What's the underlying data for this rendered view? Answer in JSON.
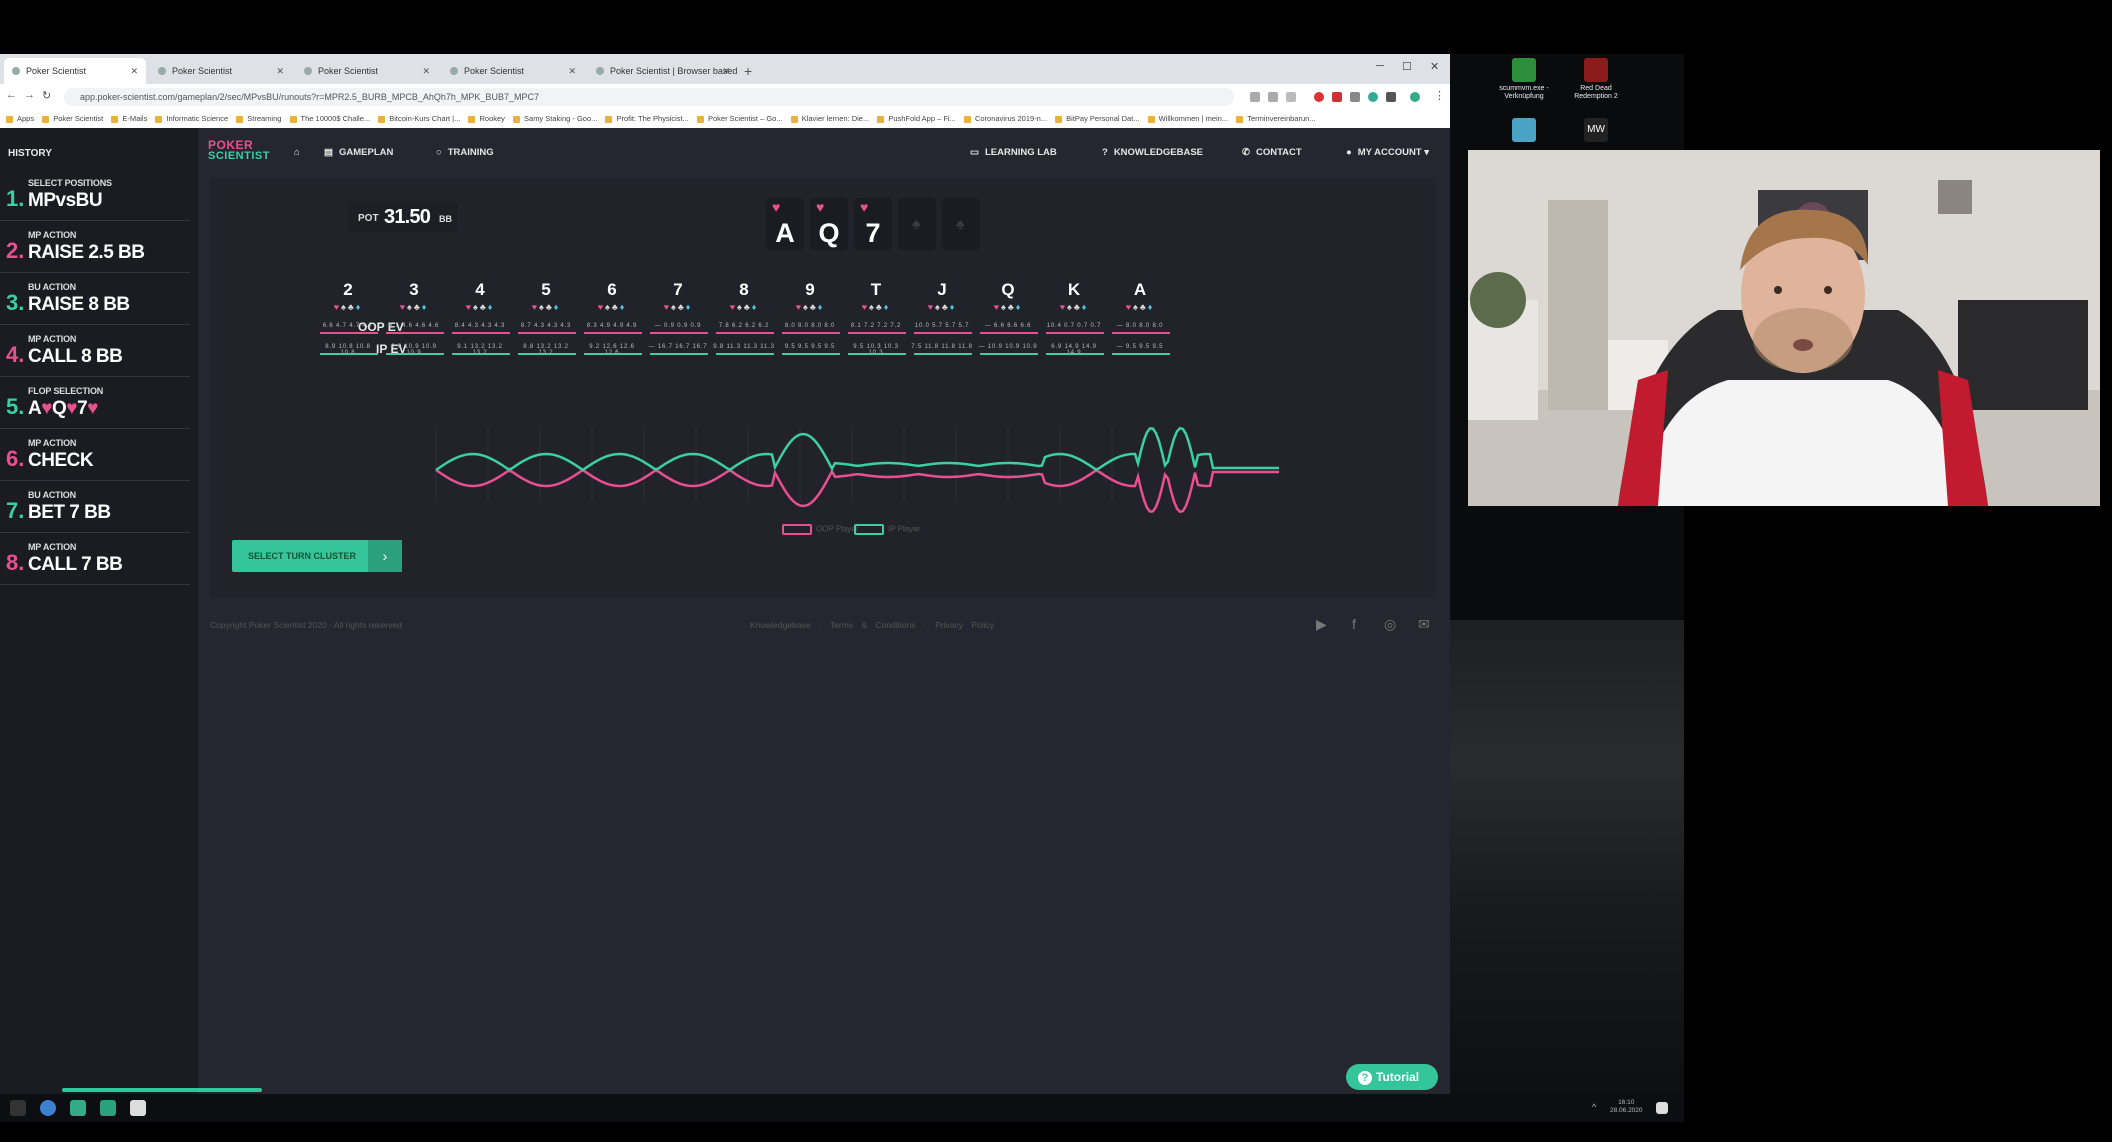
{
  "browser": {
    "tabs": [
      {
        "title": "Poker Scientist",
        "active": true
      },
      {
        "title": "Poker Scientist",
        "active": false
      },
      {
        "title": "Poker Scientist",
        "active": false
      },
      {
        "title": "Poker Scientist",
        "active": false
      },
      {
        "title": "Poker Scientist | Browser based",
        "active": false
      }
    ],
    "new_tab": "+",
    "url": "app.poker-scientist.com/gameplan/2/sec/MPvsBU/runouts?r=MPR2.5_BURB_MPCB_AhQh7h_MPK_BUB7_MPC7",
    "bookmarks": [
      "Apps",
      "Poker Scientist",
      "E-Mails",
      "Informatic Science",
      "Streaming",
      "The 10000$ Challe...",
      "Bitcoin-Kurs Chart |...",
      "Rookey",
      "Samy Staking - Goo...",
      "Profit: The Physicist...",
      "Poker Scientist – Go...",
      "Klavier lernen: Die...",
      "PushFold App – Fi...",
      "Coronavirus 2019-n...",
      "BitPay Personal Dat...",
      "Willkommen | mein...",
      "Terminvereinbarun..."
    ]
  },
  "sidebar": {
    "title": "HISTORY",
    "steps": [
      {
        "num": "1.",
        "label": "SELECT POSITIONS",
        "value": "MPvsBU",
        "color": "green"
      },
      {
        "num": "2.",
        "label": "MP ACTION",
        "value": "RAISE 2.5 BB",
        "color": "pink"
      },
      {
        "num": "3.",
        "label": "BU ACTION",
        "value": "RAISE 8 BB",
        "color": "green"
      },
      {
        "num": "4.",
        "label": "MP ACTION",
        "value": "CALL 8 BB",
        "color": "pink"
      },
      {
        "num": "5.",
        "label": "FLOP SELECTION",
        "value": "A♥Q♥7♥",
        "color": "green"
      },
      {
        "num": "6.",
        "label": "MP ACTION",
        "value": "CHECK",
        "color": "pink"
      },
      {
        "num": "7.",
        "label": "BU ACTION",
        "value": "BET 7 BB",
        "color": "green"
      },
      {
        "num": "8.",
        "label": "MP ACTION",
        "value": "CALL 7 BB",
        "color": "pink"
      }
    ]
  },
  "nav": {
    "gameplan": "GAMEPLAN",
    "training": "TRAINING",
    "learning_lab": "LEARNING LAB",
    "knowledgebase": "KNOWLEDGEBASE",
    "contact": "CONTACT",
    "account": "MY ACCOUNT"
  },
  "logo": {
    "line1": "POKER",
    "line2": "SCIENTIST"
  },
  "pot": {
    "label": "POT",
    "value": "31.50",
    "unit": "BB"
  },
  "board": {
    "cards": [
      {
        "rank": "A",
        "suit": "♥"
      },
      {
        "rank": "Q",
        "suit": "♥"
      },
      {
        "rank": "7",
        "suit": "♥"
      }
    ],
    "empty_slots": [
      "♠",
      "♠"
    ]
  },
  "runouts": {
    "ranks": [
      "2",
      "3",
      "4",
      "5",
      "6",
      "7",
      "8",
      "9",
      "T",
      "J",
      "Q",
      "K",
      "A"
    ],
    "suits": [
      "♥",
      "♠",
      "♣",
      "♦"
    ],
    "oop_label": "OOP EV",
    "ip_label": "IP EV",
    "oop_ev": [
      "6.6 4.7 4.7 4.7",
      "8.1 4.6 4.6 4.6",
      "8.4 4.3 4.3 4.3",
      "8.7 4.3 4.3 4.3",
      "8.3 4.9 4.9 4.9",
      "— 0.9 0.9 0.9",
      "7.8 6.2 6.2 6.2",
      "8.0 8.0 8.0 8.0",
      "8.1 7.2 7.2 7.2",
      "10.0 5.7 5.7 5.7",
      "— 6.6 6.6 6.6",
      "10.4 0.7 0.7 0.7",
      "— 8.0 8.0 8.0"
    ],
    "ip_ev": [
      "8.9 10.8 10.8 10.8",
      "9.0 10.9 10.9 10.9",
      "9.1 13.2 13.2 13.2",
      "8.8 13.2 13.2 13.2",
      "9.2 12.6 12.6 12.6",
      "— 16.7 16.7 16.7",
      "9.8 11.3 11.3 11.3",
      "9.5 9.5 9.5 9.5",
      "9.5 10.3 10.3 10.3",
      "7.5 11.8 11.8 11.8",
      "— 10.9 10.9 10.9",
      "6.9 14.9 14.9 14.9",
      "— 9.5 9.5 9.5"
    ]
  },
  "chart": {
    "legend": [
      "OOP Player",
      "IP Player"
    ],
    "colors": {
      "oop": "#e8508e",
      "ip": "#3ccfa3"
    }
  },
  "select_button": {
    "label": "SELECT TURN CLUSTER",
    "arrow": "›"
  },
  "footer": {
    "copyright": "Copyright Poker Scientist 2020 · All rights reserved",
    "links": "Knowledgebase · Terms & Conditions · Privacy Policy"
  },
  "tutorial": {
    "label": "Tutorial",
    "icon": "?"
  },
  "desktop": {
    "icons": [
      {
        "label": "scummvm.exe - Verknüpfung"
      },
      {
        "label": "Red Dead Redemption 2"
      }
    ]
  },
  "taskbar": {
    "time": "16:10",
    "date": "28.06.2020"
  }
}
